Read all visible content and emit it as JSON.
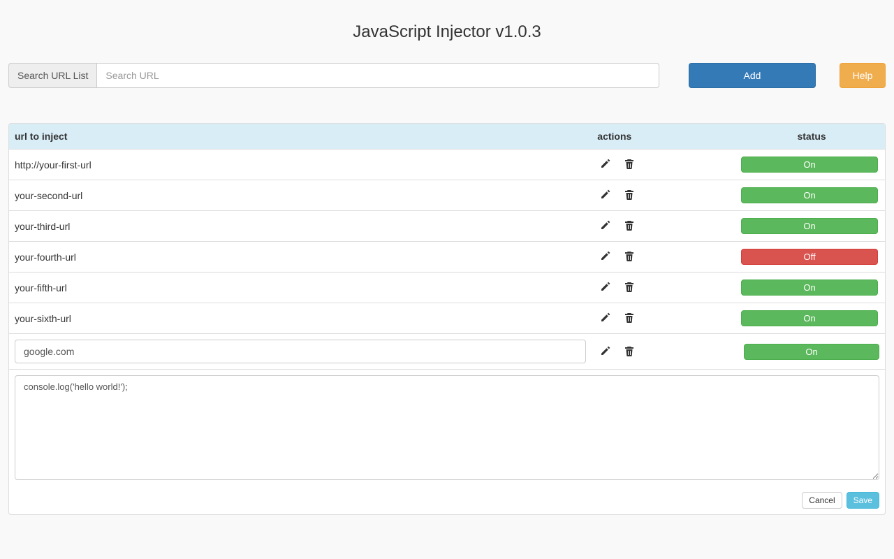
{
  "title": "JavaScript Injector v1.0.3",
  "search": {
    "addon_label": "Search URL List",
    "placeholder": "Search URL"
  },
  "buttons": {
    "add": "Add",
    "help": "Help",
    "cancel": "Cancel",
    "save": "Save"
  },
  "table": {
    "headers": {
      "url": "url to inject",
      "actions": "actions",
      "status": "status"
    },
    "rows": [
      {
        "url": "http://your-first-url",
        "status": "On",
        "on": true
      },
      {
        "url": "your-second-url",
        "status": "On",
        "on": true
      },
      {
        "url": "your-third-url",
        "status": "On",
        "on": true
      },
      {
        "url": "your-fourth-url",
        "status": "Off",
        "on": false
      },
      {
        "url": "your-fifth-url",
        "status": "On",
        "on": true
      },
      {
        "url": "your-sixth-url",
        "status": "On",
        "on": true
      }
    ],
    "edit_row": {
      "url_value": "google.com",
      "status": "On",
      "on": true,
      "code_value": "console.log('hello world!');"
    }
  }
}
